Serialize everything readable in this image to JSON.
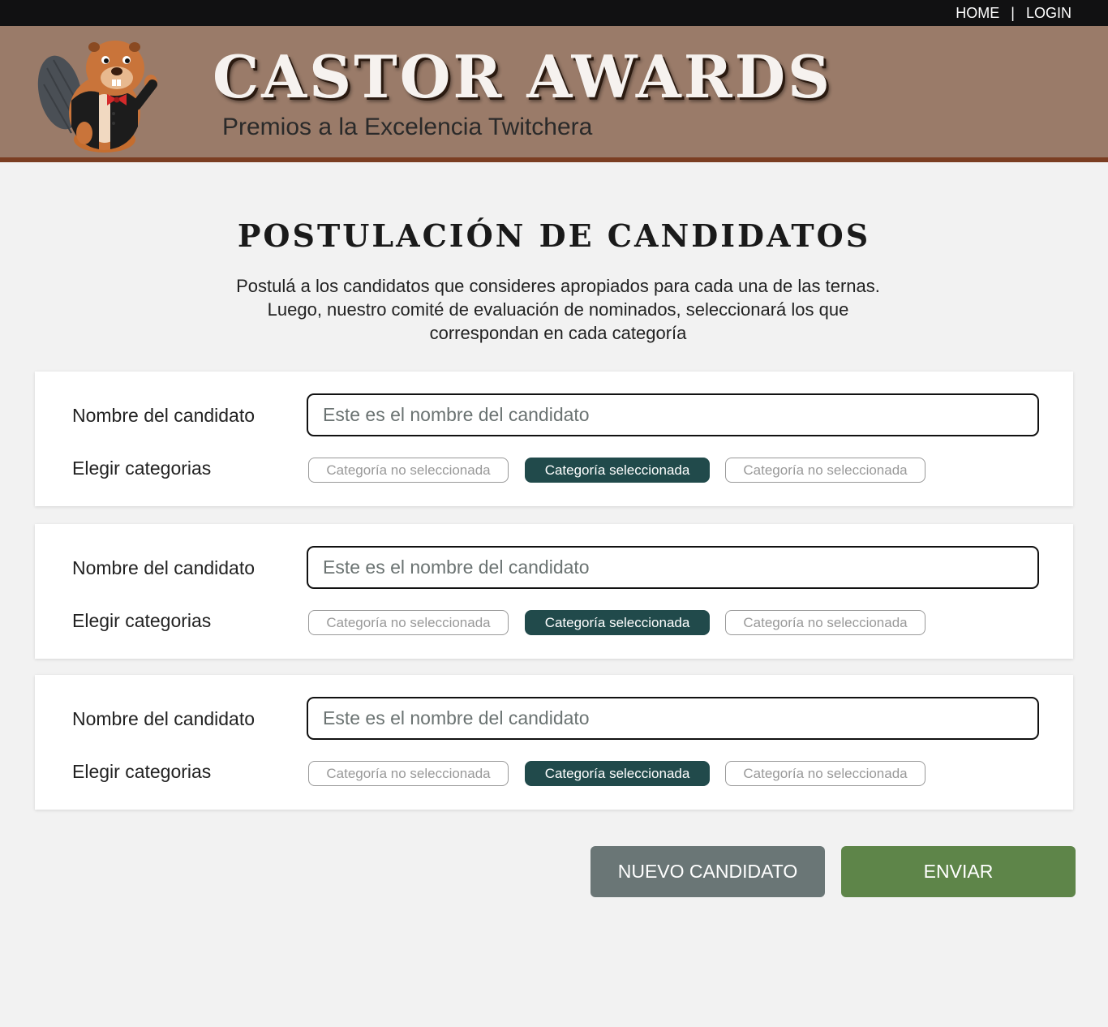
{
  "nav": {
    "home": "HOME",
    "separator": "|",
    "login": "LOGIN"
  },
  "header": {
    "title": "CASTOR AWARDS",
    "subtitle": "Premios a la Excelencia Twitchera",
    "logo_icon": "beaver-mascot-icon"
  },
  "page": {
    "title": "POSTULACIÓN DE CANDIDATOS",
    "intro_lines": [
      "Postulá a los candidatos que consideres apropiados para cada una de las ternas.",
      "Luego, nuestro comité de evaluación de nominados, seleccionará los que",
      "correspondan en cada categoría"
    ]
  },
  "candidates": [
    {
      "name_label": "Nombre del candidato",
      "name_placeholder": "Este es el nombre del candidato",
      "category_label": "Elegir categorias",
      "categories": [
        {
          "label": "Categoría no seleccionada",
          "selected": false
        },
        {
          "label": "Categoría seleccionada",
          "selected": true
        },
        {
          "label": "Categoría no seleccionada",
          "selected": false
        }
      ]
    },
    {
      "name_label": "Nombre del candidato",
      "name_placeholder": "Este es el nombre del candidato",
      "category_label": "Elegir categorias",
      "categories": [
        {
          "label": "Categoría no seleccionada",
          "selected": false
        },
        {
          "label": "Categoría seleccionada",
          "selected": true
        },
        {
          "label": "Categoría no seleccionada",
          "selected": false
        }
      ]
    },
    {
      "name_label": "Nombre del candidato",
      "name_placeholder": "Este es el nombre del candidato",
      "category_label": "Elegir categorias",
      "categories": [
        {
          "label": "Categoría no seleccionada",
          "selected": false
        },
        {
          "label": "Categoría seleccionada",
          "selected": true
        },
        {
          "label": "Categoría no seleccionada",
          "selected": false
        }
      ]
    }
  ],
  "actions": {
    "new_candidate": "NUEVO CANDIDATO",
    "submit": "ENVIAR"
  },
  "colors": {
    "topbar": "#111112",
    "header_bg": "#9a7b69",
    "header_border": "#7b3e22",
    "chip_selected": "#214a4b",
    "new_button": "#6a7676",
    "submit_button": "#5e8549"
  }
}
